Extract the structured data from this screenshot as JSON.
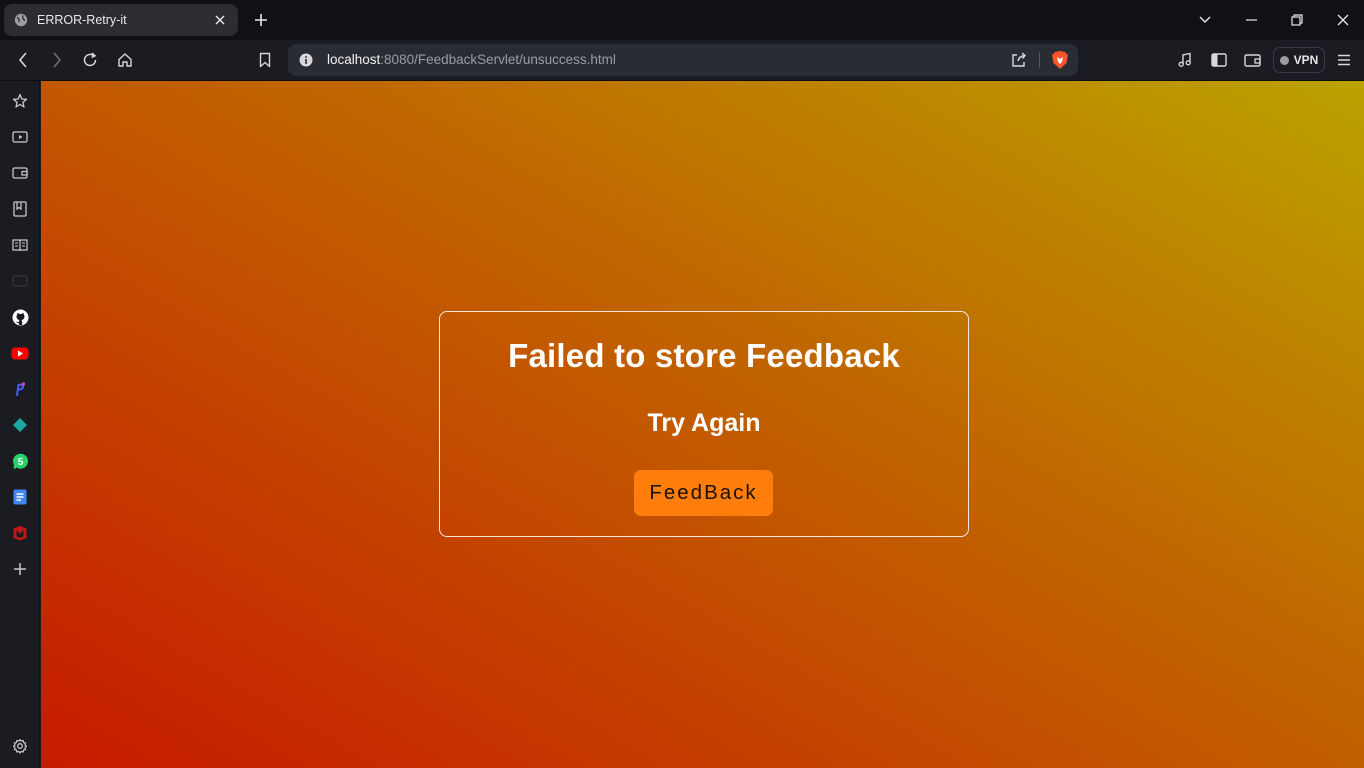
{
  "browser": {
    "tab": {
      "title": "ERROR-Retry-it"
    },
    "url": {
      "host": "localhost",
      "path": ":8080/FeedbackServlet/unsuccess.html"
    },
    "vpn_label": "VPN",
    "sidebar_icons": [
      "star-icon",
      "video-icon",
      "wallet-icon",
      "bookmarks-icon",
      "reading-list-icon",
      "disabled-icon",
      "github-icon",
      "youtube-icon",
      "app-icon",
      "diamond-icon",
      "whatsapp-icon",
      "docs-icon",
      "mcafee-icon",
      "add-icon",
      "settings-icon"
    ]
  },
  "page": {
    "heading": "Failed to store Feedback",
    "subheading": "Try Again",
    "button_label": "FeedBack"
  }
}
